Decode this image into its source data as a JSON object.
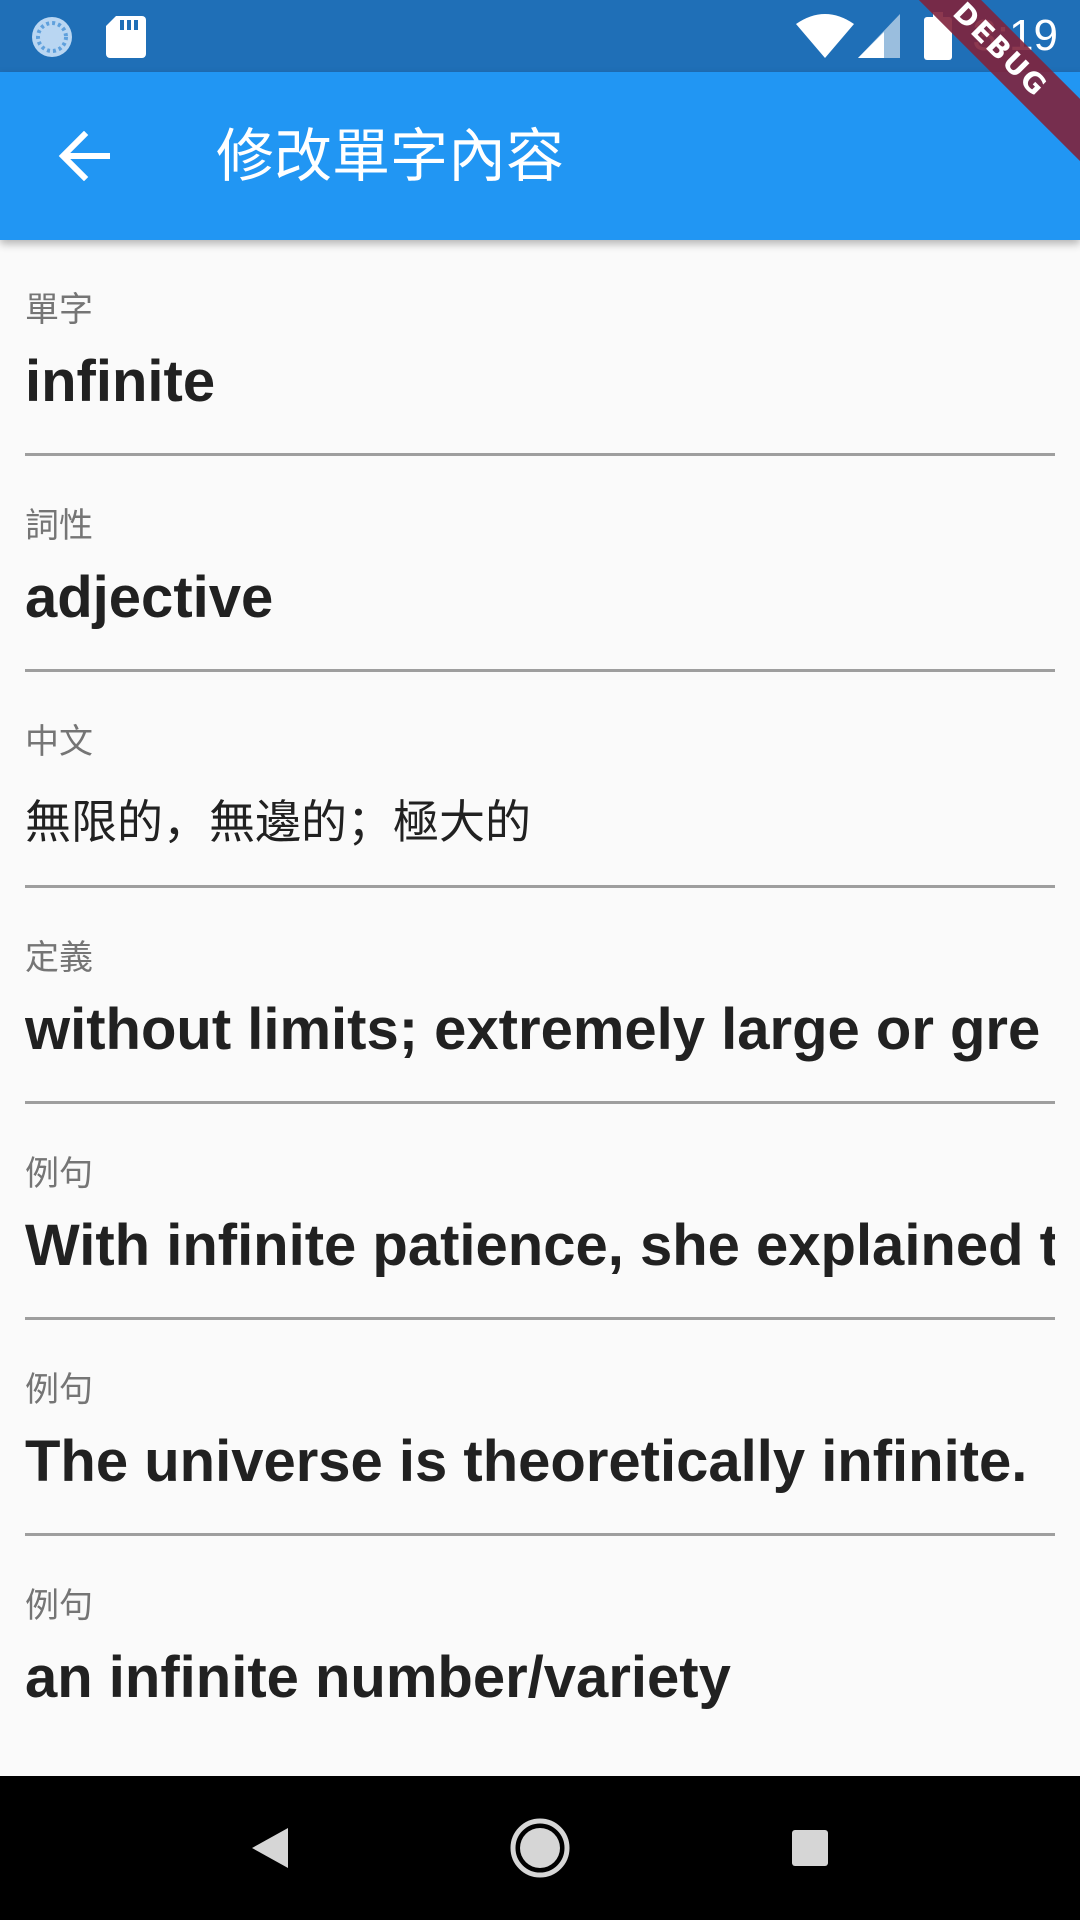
{
  "status_bar": {
    "time": "3:19",
    "debug_label": "DEBUG",
    "icons": [
      "sync-icon",
      "sd-card-icon",
      "wifi-icon",
      "signal-icon",
      "battery-icon"
    ]
  },
  "app_bar": {
    "title": "修改單字內容",
    "back_icon": "arrow-back-icon"
  },
  "fields": [
    {
      "label": "單字",
      "value": "infinite"
    },
    {
      "label": "詞性",
      "value": "adjective"
    },
    {
      "label": "中文",
      "value": "無限的，無邊的；極大的"
    },
    {
      "label": "定義",
      "value": "without limits; extremely large or gre"
    },
    {
      "label": "例句",
      "value": "With infinite patience, she explained t"
    },
    {
      "label": "例句",
      "value": "The universe is theoretically infinite."
    },
    {
      "label": "例句",
      "value": "an infinite number/variety"
    }
  ],
  "nav_bar": {
    "icons": [
      "back-triangle-icon",
      "home-circle-icon",
      "recents-square-icon"
    ]
  },
  "colors": {
    "status_bar": "#1f6fb7",
    "app_bar": "#2196f3",
    "background": "#fafafa",
    "divider": "#9e9e9e",
    "label": "#757575",
    "value": "#212121",
    "debug_ribbon": "#80223c"
  }
}
